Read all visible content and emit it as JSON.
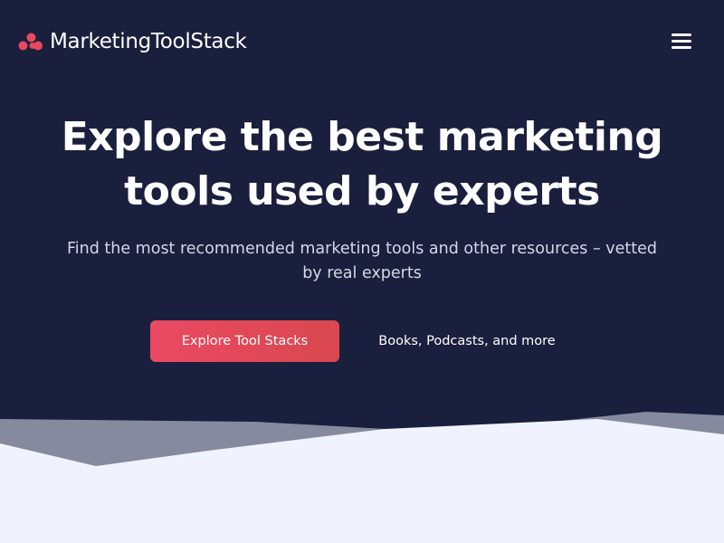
{
  "colors": {
    "hero_background": "#1a1f3d",
    "accent": "#e84b5d",
    "light_section": "#f0f3fd",
    "wave_gray": "#858a9f"
  },
  "header": {
    "logo_icon": "three-dots-logo-icon",
    "logo_text": "MarketingToolStack",
    "menu_icon": "hamburger-menu-icon"
  },
  "hero": {
    "title_line1": "Explore the best marketing",
    "title_line2": "tools used by experts",
    "subtitle_line1": "Find the most recommended marketing tools and other resources – vetted",
    "subtitle_line2": "by real experts",
    "primary_cta": "Explore Tool Stacks",
    "secondary_cta": "Books, Podcasts, and more"
  }
}
